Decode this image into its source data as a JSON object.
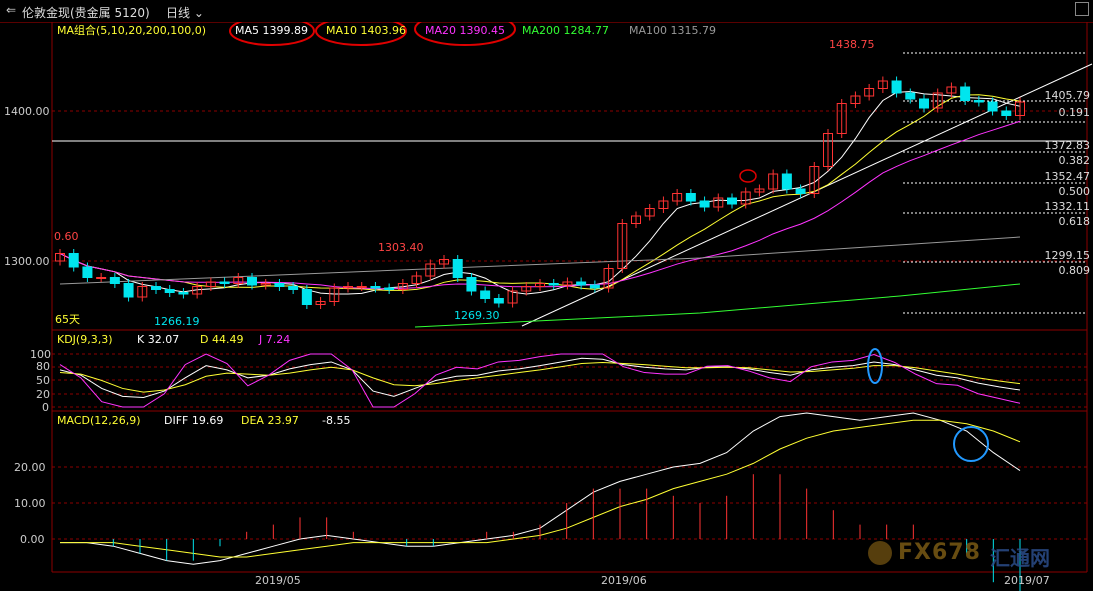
{
  "header": {
    "back_glyph": "⇐",
    "instrument": "伦敦金现(贵金属 5120)",
    "period": "日线",
    "period_arrow": "⌵"
  },
  "ma_legend": {
    "group_label": "MA组合(5,10,20,200,100,0)",
    "items": [
      {
        "label": "MA5 1399.89",
        "color": "#ffffff"
      },
      {
        "label": "MA10 1403.96",
        "color": "#ffff33"
      },
      {
        "label": "MA20 1390.45",
        "color": "#ff33ff"
      },
      {
        "label": "MA200 1284.77",
        "color": "#33ff33"
      },
      {
        "label": "MA100 1315.79",
        "color": "#999999"
      }
    ]
  },
  "price_axis": [
    "1400.00",
    "1300.00"
  ],
  "price_annotations": {
    "high": "1438.75",
    "mid_high": "1303.40",
    "low1": "1266.19",
    "low2": "1269.30",
    "left_val": "0.60",
    "days": "65天"
  },
  "fib_levels": [
    {
      "price": "1405.79",
      "ratio": "0.191"
    },
    {
      "price": "1372.83",
      "ratio": "0.382"
    },
    {
      "price": "1352.47",
      "ratio": "0.500"
    },
    {
      "price": "1332.11",
      "ratio": "0.618"
    },
    {
      "price": "1299.15",
      "ratio": "0.809"
    }
  ],
  "kdj": {
    "label": "KDJ(9,3,3)",
    "k": "K 32.07",
    "d": "D 44.49",
    "j": "J 7.24",
    "axis": [
      "100",
      "80",
      "50",
      "20",
      "0"
    ]
  },
  "macd": {
    "label": "MACD(12,26,9)",
    "diff": "DIFF 19.69",
    "dea": "DEA 23.97",
    "hist": "-8.55",
    "axis": [
      "20.00",
      "10.00",
      "0.00"
    ]
  },
  "dates": [
    "2019/05",
    "2019/06",
    "2019/07"
  ],
  "watermark": {
    "text": "FX678",
    "text2": "汇通网"
  },
  "colors": {
    "up": "#ff3333",
    "down": "#00e5ee",
    "ma5": "#ffffff",
    "ma10": "#ffff33",
    "ma20": "#ff33ff",
    "ma200": "#33ff33",
    "ma100": "#999999",
    "grid": "#8b0000"
  }
}
